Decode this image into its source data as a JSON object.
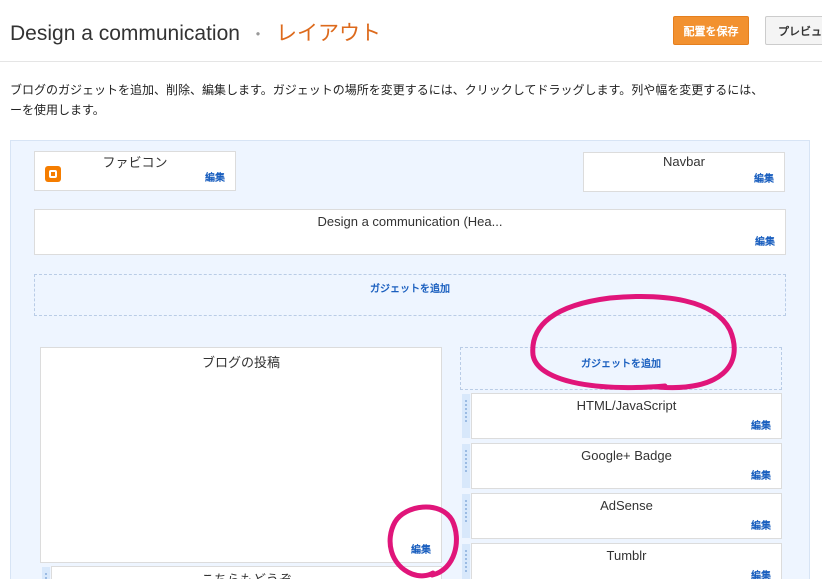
{
  "header": {
    "blog_title": "Design a communication",
    "separator": "・",
    "page_name": "レイアウト",
    "save_label": "配置を保存",
    "preview_label": "プレビュ"
  },
  "instructions": {
    "line1": "ブログのガジェットを追加、削除、編集します。ガジェットの場所を変更するには、クリックしてドラッグします。列や幅を変更するには、",
    "line2": "ーを使用します。"
  },
  "layout": {
    "favicon": {
      "title": "ファビコン",
      "edit": "編集"
    },
    "navbar": {
      "title": "Navbar",
      "edit": "編集"
    },
    "header_gadget": {
      "title": "Design a communication (Hea...",
      "edit": "編集"
    },
    "add_gadget_top": "ガジェットを追加",
    "main": {
      "title": "ブログの投稿",
      "edit": "編集"
    },
    "main_below": {
      "title": "こちらもどうぞ"
    },
    "sidebar": {
      "add_gadget": "ガジェットを追加",
      "gadgets": [
        {
          "title": "HTML/JavaScript",
          "edit": "編集"
        },
        {
          "title": "Google+ Badge",
          "edit": "編集"
        },
        {
          "title": "AdSense",
          "edit": "編集"
        },
        {
          "title": "Tumblr",
          "edit": "編集"
        }
      ]
    }
  },
  "colors": {
    "accent": "#dd6a1c",
    "save_button": "#f29130",
    "link": "#1a5fbf",
    "annotation": "#e0157a",
    "canvas": "#eef5ff"
  },
  "icons": {
    "favicon": "blogger-icon"
  }
}
